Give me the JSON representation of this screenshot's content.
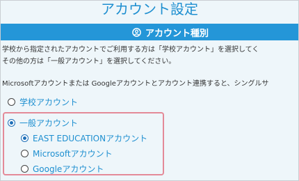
{
  "page": {
    "title": "アカウント設定"
  },
  "section": {
    "icon": "user-circle-icon",
    "title": "アカウント種別"
  },
  "description": {
    "line1": "学校から指定されたアカウントでご利用する方は「学校アカウント」を選択してく",
    "line2": "その他の方は「一般アカウント」を選択してください。",
    "line3": "Microsoftアカウントまたは Googleアカウントとアカウント連携すると、シングルサ"
  },
  "options": {
    "school": {
      "label": "学校アカウント",
      "checked": false
    },
    "general": {
      "label": "一般アカウント",
      "checked": true,
      "sub": [
        {
          "label": "EAST EDUCATIONアカウント",
          "checked": true
        },
        {
          "label": "Microsoftアカウント",
          "checked": false
        },
        {
          "label": "Googleアカウント",
          "checked": false
        }
      ]
    }
  },
  "colors": {
    "accent": "#1e8fd0",
    "bar": "#2496d8",
    "highlight_border": "#e48a98"
  }
}
